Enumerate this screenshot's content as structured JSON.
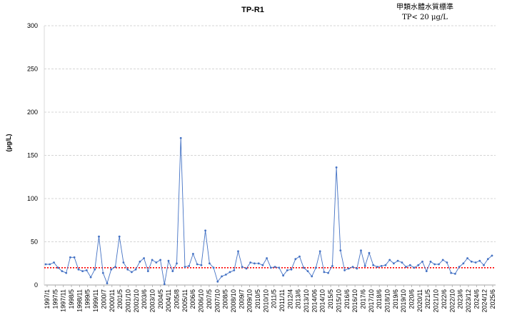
{
  "chart_data": {
    "type": "line",
    "title": "TP-R1",
    "ylabel": "(μg/L)",
    "xlabel": "",
    "ylim": [
      0,
      300
    ],
    "yticks": [
      0,
      50,
      100,
      150,
      200,
      250,
      300
    ],
    "grid": true,
    "standard_note": {
      "line1": "甲類水體水質標準",
      "line2": "TP< 20 μg/L"
    },
    "standard": {
      "value": 20,
      "color": "#ff0000"
    },
    "series_color": "#4472c4",
    "x_labels": [
      "1997/1",
      "1997/5",
      "1997/11",
      "1998/5",
      "1998/11",
      "1999/5",
      "1999/11",
      "2000/7",
      "2000/11",
      "2001/5",
      "2001/10",
      "2002/10",
      "2003/6",
      "2003/10",
      "2004/5",
      "2004/11",
      "2005/8",
      "2005/11",
      "2006/6",
      "2006/10",
      "2007/5",
      "2007/10",
      "2008/5",
      "2008/10",
      "2009/7",
      "2009/10",
      "2010/5",
      "2010/10",
      "2011/5",
      "2011/11",
      "2012/4",
      "2013/6",
      "2013/10",
      "2014/06",
      "2014/10",
      "2015/5",
      "2015/10",
      "2016/6",
      "2016/10",
      "2017/6",
      "2017/10",
      "2018/6",
      "2018/10",
      "2019/6",
      "2019/10",
      "2020/6",
      "2020/11",
      "2021/5",
      "2021/10",
      "2022/6",
      "2022/10",
      "2023/6",
      "2023/12",
      "2024/6",
      "2024/12",
      "2025/6"
    ],
    "values": [
      24,
      24,
      26,
      20,
      16,
      14,
      32,
      32,
      18,
      16,
      17,
      9,
      18,
      56,
      14,
      2,
      18,
      21,
      56,
      26,
      18,
      15,
      18,
      27,
      31,
      16,
      29,
      26,
      29,
      1,
      28,
      16,
      25,
      170,
      21,
      22,
      36,
      24,
      23,
      63,
      25,
      20,
      4,
      10,
      12,
      15,
      17,
      39,
      21,
      19,
      26,
      25,
      25,
      23,
      31,
      20,
      21,
      20,
      11,
      17,
      18,
      30,
      33,
      20,
      16,
      10,
      20,
      39,
      15,
      14,
      22,
      136,
      40,
      17,
      19,
      21,
      19,
      40,
      22,
      37,
      23,
      21,
      22,
      23,
      29,
      25,
      28,
      26,
      21,
      23,
      20,
      23,
      27,
      16,
      27,
      24,
      24,
      29,
      26,
      14,
      13,
      21,
      25,
      31,
      27,
      26,
      28,
      23,
      30,
      34
    ]
  }
}
